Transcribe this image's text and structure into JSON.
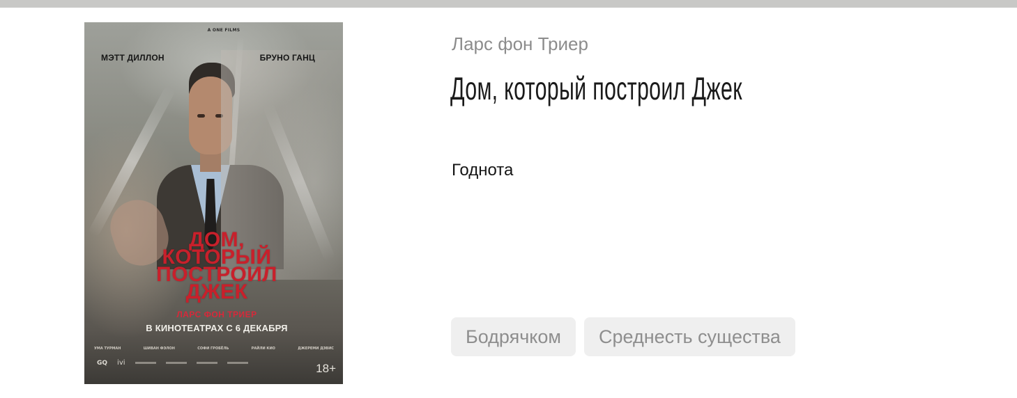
{
  "poster": {
    "brand": "A ONE FILMS",
    "actor_left": "МЭТТ ДИЛЛОН",
    "actor_right": "БРУНО ГАНЦ",
    "title_lines": [
      "ДОМ,",
      "КОТОРЫЙ",
      "ПОСТРОИЛ",
      "ДЖЕК"
    ],
    "director": "ЛАРС ФОН ТРИЕР",
    "release": "В КИНОТЕАТРАХ С 6 ДЕКАБРЯ",
    "cast": [
      "УМА ТУРМАН",
      "ШИВАН ФЭЛОН",
      "СОФИ ГРОБЁЛЬ",
      "РАЙЛИ КИО",
      "ДЖЕРЕМИ ДЭВИС"
    ],
    "logo_gq": "GQ",
    "logo_ivi": "ivi",
    "age_rating": "18+"
  },
  "movie": {
    "director": "Ларс фон Триер",
    "title": "Дом, который построил Джек",
    "review": "Годнота"
  },
  "tags": [
    "Бодрячком",
    "Среднесть существа"
  ]
}
